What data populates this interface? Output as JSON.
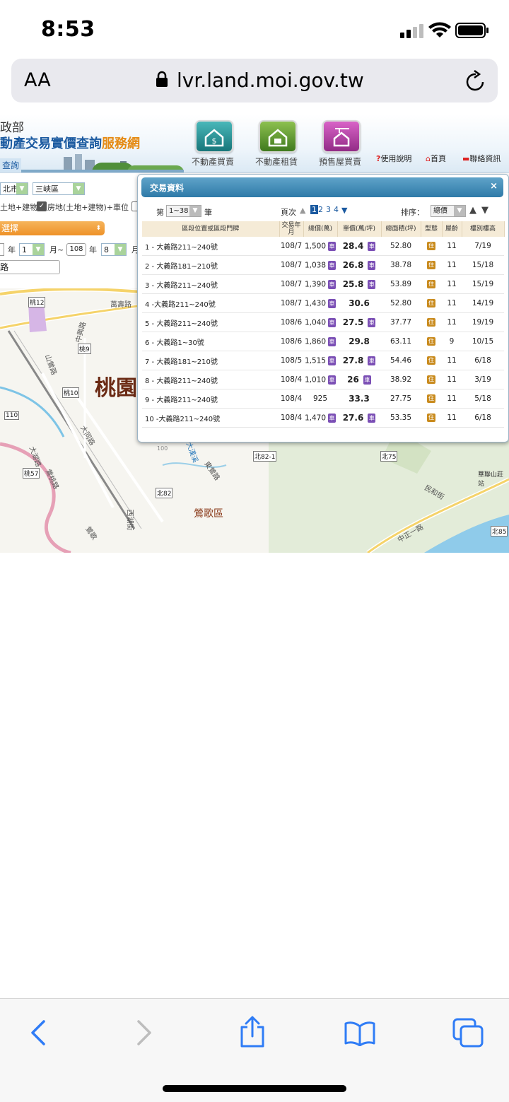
{
  "status_bar": {
    "time": "8:53"
  },
  "safari": {
    "aa_label": "AA",
    "url": "lvr.land.moi.gov.tw"
  },
  "site": {
    "title_top": "政部",
    "title_main": "動產交易實價查詢",
    "title_accent": "服務網",
    "query_tab": "查詢",
    "nav": [
      {
        "label": "不動產買賣",
        "color": "#1b8a8c"
      },
      {
        "label": "不動產租賃",
        "color": "#4e8a2a"
      },
      {
        "label": "預售屋買賣",
        "color": "#b13aa3"
      }
    ],
    "top_links": {
      "help": "使用說明",
      "home": "首頁",
      "contact": "聯絡資訊"
    }
  },
  "filters": {
    "city": "北市",
    "district": "三峽區",
    "land_types": "土地+建物)",
    "land_types_checked": "房地(土地+建物)+車位",
    "orange_select": "選擇",
    "year_unit": "年",
    "start_month": "1",
    "month_to": "月~",
    "end_year": "108",
    "end_month": "8",
    "month_unit": "月",
    "road": "路"
  },
  "map": {
    "district_label": "桃園",
    "district_label2": "鶯歌區",
    "route_labels": [
      "桃12",
      "桃9",
      "桃10",
      "110",
      "桃57",
      "北82",
      "北82-1",
      "北75",
      "北85"
    ],
    "road_labels": [
      "萬壽路",
      "中興路",
      "山鶯路",
      "大湖路",
      "大同路",
      "鶯桃路",
      "東鶯路",
      "民和街",
      "西湖街",
      "中正一路",
      "鶯歌",
      "大漢溪",
      "100"
    ],
    "site_label": "華聯山莊站"
  },
  "dialog": {
    "title": "交易資料",
    "close": "×",
    "range_prefix": "第",
    "range_value": "1~38",
    "range_suffix": "筆",
    "page_label": "頁次",
    "pages": [
      "1",
      "2",
      "3",
      "4"
    ],
    "sort_label": "排序：",
    "sort_value": "總價",
    "columns": [
      "區段位置或區段門牌",
      "交易年月",
      "總價(萬)",
      "單價(萬/坪)",
      "總面積(坪)",
      "型態",
      "屋齡",
      "樓別樓高"
    ],
    "car_badge": "車",
    "type_badge": "住",
    "rows": [
      {
        "no": "1",
        "addr": "大義路211~240號",
        "ym": "108/7",
        "total": "1,500",
        "car": true,
        "unit": "28.4",
        "ucar": true,
        "area": "52.80",
        "age": "11",
        "floor": "7/19"
      },
      {
        "no": "2",
        "addr": "大義路181~210號",
        "ym": "108/7",
        "total": "1,038",
        "car": true,
        "unit": "26.8",
        "ucar": true,
        "area": "38.78",
        "age": "11",
        "floor": "15/18"
      },
      {
        "no": "3",
        "addr": "大義路211~240號",
        "ym": "108/7",
        "total": "1,390",
        "car": true,
        "unit": "25.8",
        "ucar": true,
        "area": "53.89",
        "age": "11",
        "floor": "15/19"
      },
      {
        "no": "4",
        "addr": "大義路211~240號",
        "ym": "108/7",
        "total": "1,430",
        "car": true,
        "unit": "30.6",
        "ucar": false,
        "area": "52.80",
        "age": "11",
        "floor": "14/19"
      },
      {
        "no": "5",
        "addr": "大義路211~240號",
        "ym": "108/6",
        "total": "1,040",
        "car": true,
        "unit": "27.5",
        "ucar": true,
        "area": "37.77",
        "age": "11",
        "floor": "19/19"
      },
      {
        "no": "6",
        "addr": "大義路1~30號",
        "ym": "108/6",
        "total": "1,860",
        "car": true,
        "unit": "29.8",
        "ucar": false,
        "area": "63.11",
        "age": "9",
        "floor": "10/15"
      },
      {
        "no": "7",
        "addr": "大義路181~210號",
        "ym": "108/5",
        "total": "1,515",
        "car": true,
        "unit": "27.8",
        "ucar": true,
        "area": "54.46",
        "age": "11",
        "floor": "6/18"
      },
      {
        "no": "8",
        "addr": "大義路211~240號",
        "ym": "108/4",
        "total": "1,010",
        "car": true,
        "unit": "26",
        "ucar": true,
        "area": "38.92",
        "age": "11",
        "floor": "3/19"
      },
      {
        "no": "9",
        "addr": "大義路211~240號",
        "ym": "108/4",
        "total": "925",
        "car": false,
        "unit": "33.3",
        "ucar": false,
        "area": "27.75",
        "age": "11",
        "floor": "5/18"
      },
      {
        "no": "10",
        "addr": "大義路211~240號",
        "ym": "108/4",
        "total": "1,470",
        "car": true,
        "unit": "27.6",
        "ucar": true,
        "area": "53.35",
        "age": "11",
        "floor": "6/18"
      }
    ]
  },
  "toolbar_icons": [
    "back-arrow",
    "forward-arrow",
    "share",
    "bookmarks",
    "tabs"
  ]
}
